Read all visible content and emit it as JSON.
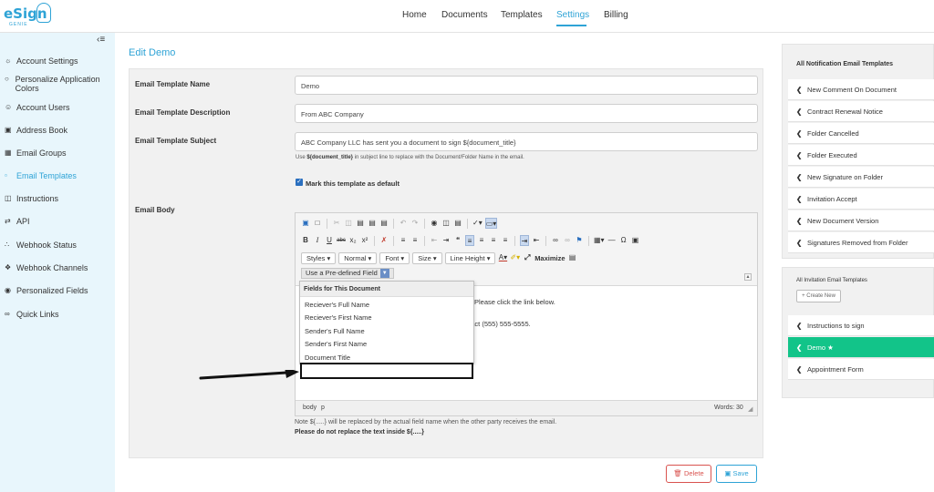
{
  "app": {
    "logo_text": "eSign",
    "logo_sub": "GENIE"
  },
  "nav": {
    "items": [
      "Home",
      "Documents",
      "Templates",
      "Settings",
      "Billing"
    ],
    "active": "Settings",
    "accent_color": "#2ea3d6"
  },
  "sidebar": {
    "collapse_icon": "collapse-icon",
    "items": [
      {
        "icon": "account-icon",
        "label": "Account Settings"
      },
      {
        "icon": "palette-icon",
        "label": "Personalize Application Colors"
      },
      {
        "icon": "users-icon",
        "label": "Account Users"
      },
      {
        "icon": "address-book-icon",
        "label": "Address Book"
      },
      {
        "icon": "group-icon",
        "label": "Email Groups"
      },
      {
        "icon": "email-template-icon",
        "label": "Email Templates"
      },
      {
        "icon": "instructions-icon",
        "label": "Instructions"
      },
      {
        "icon": "api-icon",
        "label": "API"
      },
      {
        "icon": "webhook-icon",
        "label": "Webhook Status"
      },
      {
        "icon": "channels-icon",
        "label": "Webhook Channels"
      },
      {
        "icon": "fields-icon",
        "label": "Personalized Fields"
      },
      {
        "icon": "link-icon",
        "label": "Quick Links"
      }
    ],
    "active_index": 5
  },
  "main": {
    "title": "Edit Demo",
    "fields": {
      "name_label": "Email Template Name",
      "name_value": "Demo",
      "desc_label": "Email Template Description",
      "desc_value": "From ABC Company",
      "subject_label": "Email Template Subject",
      "subject_value": "ABC Company LLC has sent you a document to sign ${document_title}",
      "subject_hint_pre": "Use",
      "subject_hint_code": "${document_title}",
      "subject_hint_post": "in subject line to replace with the Document/Folder Name in the email.",
      "default_checkbox_label": "Mark this template as default",
      "default_checked": true,
      "body_label": "Email Body"
    },
    "editor": {
      "toolbar_combos": [
        "Styles",
        "Normal",
        "Font",
        "Size",
        "Line Height"
      ],
      "maximize_label": "Maximize",
      "predefined_button": "Use a Pre-defined Field",
      "body_lines": [
        "Please click the link below.",
        "ntact (555) 555-5555."
      ],
      "status_path": [
        "body",
        "p"
      ],
      "word_count": "Words: 30"
    },
    "dropdown": {
      "header": "Fields for This Document",
      "items": [
        "Reciever's Full Name",
        "Reciever's First Name",
        "Sender's Full Name",
        "Sender's First Name",
        "Document Title"
      ]
    },
    "note": "Note ${.....} will be replaced by the actual field name when the other party receives the email.",
    "note_bold": "Please do not replace the text inside ${.....}",
    "buttons": {
      "delete": "Delete",
      "save": "Save"
    }
  },
  "right": {
    "notification_title": "All Notification Email Templates",
    "notification_items": [
      "New Comment On Document",
      "Contract Renewal Notice",
      "Folder Cancelled",
      "Folder Executed",
      "New Signature on Folder",
      "Invitation Accept",
      "New Document Version",
      "Signatures Removed from Folder"
    ],
    "invitation_title": "All Invitation Email Templates",
    "create_new": "Create New",
    "invitation_items": [
      "Instructions to sign",
      "Demo ★",
      "Appointment Form"
    ],
    "active_invitation": 1,
    "active_color": "#12c489"
  }
}
